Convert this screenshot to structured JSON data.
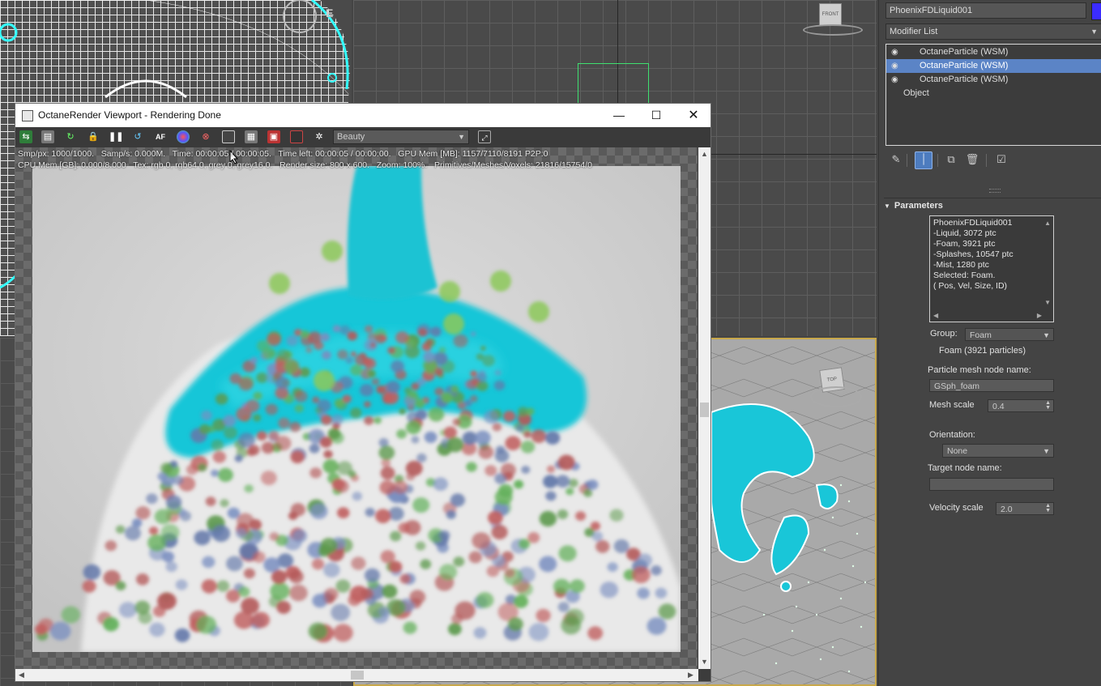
{
  "viewcube": {
    "front_label": "FRONT",
    "top_label": "TOP",
    "front_label2": "FRONT",
    "edge_label": "E"
  },
  "octane": {
    "title": "OctaneRender Viewport - Rendering Done",
    "pass_dropdown": "Beauty",
    "stats_line1": "Smp/px: 1000/1000.   Samp/s: 0.000M.   Time: 00:00:05 / 00:00:05.   Time left: 00:00:05 / 00:00:00.   GPU Mem [MB]: 1157/7110/8191 P2P:0",
    "stats_line2": "CPU Mem [GB]: 0.000/8.000   Tex: rgb 0, rgb64 0, grey 0, grey16 0.   Render size: 800 x 600.   Zoom: 100%.   Primitives/Meshes/Voxels: 21816/15754/0",
    "toolbar_icons": [
      "refresh-icon",
      "clipboard-icon",
      "reset-icon",
      "lock-icon",
      "pause-icon",
      "restart-icon",
      "af-icon",
      "color-icon",
      "region-icon",
      "display-icon",
      "film-icon",
      "camera-icon",
      "cube-icon",
      "settings-icon"
    ],
    "af_label": "AF"
  },
  "panel": {
    "object_name": "PhoenixFDLiquid001",
    "modifier_list": "Modifier List",
    "stack": [
      {
        "label": "OctaneParticle (WSM)",
        "selected": false
      },
      {
        "label": "OctaneParticle (WSM)",
        "selected": true
      },
      {
        "label": "OctaneParticle (WSM)",
        "selected": false
      }
    ],
    "stack_object": "Object",
    "rollout_title": "Parameters",
    "info_lines": [
      "PhoenixFDLiquid001",
      "-Liquid, 3072 ptc",
      "-Foam, 3921 ptc",
      "-Splashes, 10547 ptc",
      "-Mist, 1280 ptc",
      "Selected: Foam.",
      "( Pos, Vel, Size, ID)"
    ],
    "group_label": "Group:",
    "group_value": "Foam",
    "group_info": "Foam (3921 particles)",
    "mesh_node_label": "Particle mesh node name:",
    "mesh_node_value": "GSph_foam",
    "mesh_scale_label": "Mesh scale",
    "mesh_scale_value": "0.4",
    "orientation_label": "Orientation:",
    "orientation_value": "None",
    "target_label": "Target node name:",
    "target_value": "",
    "velocity_label": "Velocity scale",
    "velocity_value": "2.0"
  },
  "colors": {
    "selection": "#5b84c6",
    "liquid": "#19c6d8",
    "swatch": "#3b2cff",
    "active_viewport_border": "#c8a84b"
  }
}
